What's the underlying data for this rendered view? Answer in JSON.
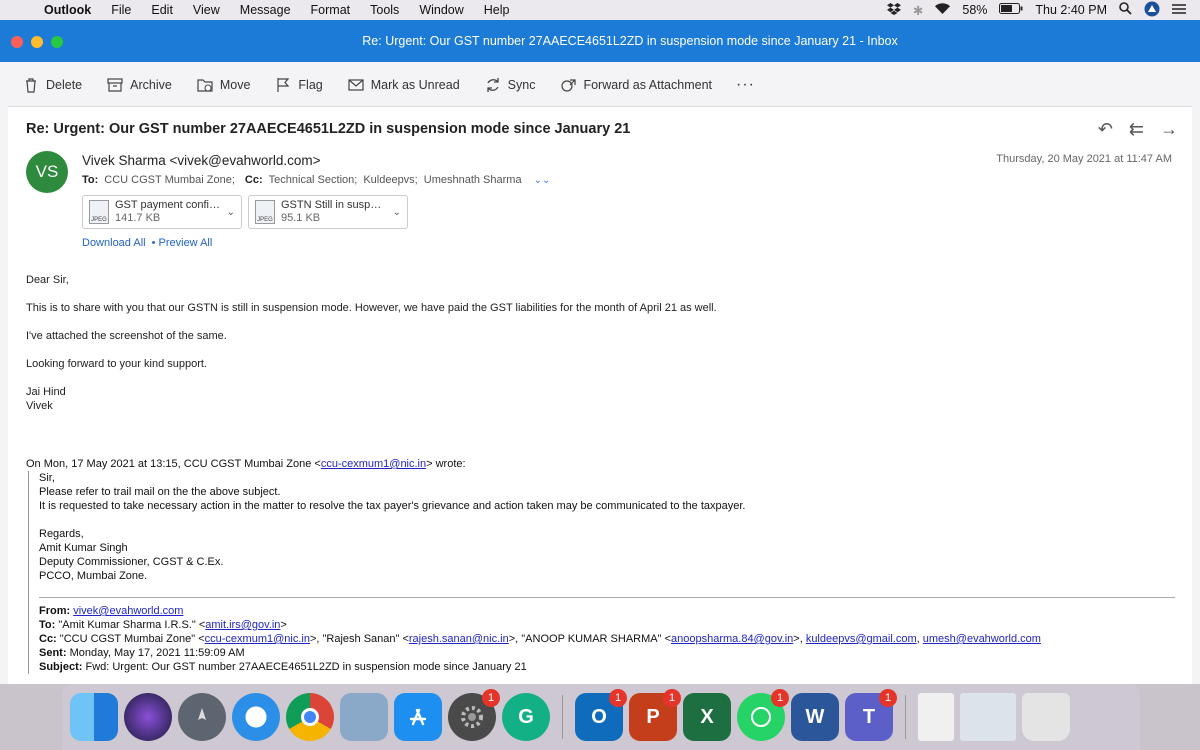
{
  "menubar": {
    "app_name": "Outlook",
    "items": [
      "File",
      "Edit",
      "View",
      "Message",
      "Format",
      "Tools",
      "Window",
      "Help"
    ],
    "battery": "58%",
    "clock": "Thu 2:40 PM"
  },
  "window": {
    "title": "Re: Urgent: Our GST number 27AAECE4651L2ZD in suspension mode since January 21 - Inbox"
  },
  "toolbar": {
    "delete": "Delete",
    "archive": "Archive",
    "move": "Move",
    "flag": "Flag",
    "mark_unread": "Mark as Unread",
    "sync": "Sync",
    "forward_attachment": "Forward as Attachment",
    "more": "···"
  },
  "message": {
    "subject": "Re: Urgent: Our GST number 27AAECE4651L2ZD in suspension mode since January 21",
    "avatar_initials": "VS",
    "sender": "Vivek Sharma <vivek@evahworld.com>",
    "date": "Thursday, 20 May 2021 at 11:47 AM",
    "to_label": "To:",
    "to": "CCU CGST Mumbai Zone;",
    "cc_label": "Cc:",
    "cc": [
      "Technical Section;",
      "Kuldeepvs;",
      "Umeshnath Sharma"
    ],
    "attachments": [
      {
        "name": "GST payment confir...",
        "size": "141.7 KB",
        "type": "JPEG"
      },
      {
        "name": "GSTN Still in suspen...",
        "size": "95.1 KB",
        "type": "JPEG"
      }
    ],
    "download_all": "Download All",
    "preview_all": "• Preview All",
    "body": [
      "Dear Sir,",
      "This is to share with you that our GSTN is still in suspension mode. However, we have paid the GST liabilities for the month of April 21 as well.",
      "I've attached the screenshot of the same.",
      "Looking forward to your kind support.",
      "Jai Hind",
      "Vivek"
    ],
    "quote": {
      "intro_pre": "On Mon, 17 May 2021 at 13:15, CCU CGST Mumbai Zone <",
      "intro_email": "ccu-cexmum1@nic.in",
      "intro_post": "> wrote:",
      "lines": [
        "Sir,",
        "Please refer to trail mail on the the above subject.",
        "It is requested to take necessary action in the matter to resolve the tax payer's grievance and action taken may be communicated to the taxpayer."
      ],
      "signature": [
        "Regards,",
        "Amit Kumar Singh",
        "Deputy Commissioner, CGST & C.Ex.",
        "PCCO, Mumbai Zone."
      ],
      "fwd": {
        "from_label": "From:",
        "from": "vivek@evahworld.com",
        "to_label": "To:",
        "to_pre": "\"Amit Kumar Sharma I.R.S.\" <",
        "to_email": "amit.irs@gov.in",
        "to_post": ">",
        "cc_label": "Cc:",
        "cc_1_pre": "\"CCU CGST Mumbai Zone\" <",
        "cc_1_email": "ccu-cexmum1@nic.in",
        "cc_2_pre": ">, \"Rajesh Sanan\" <",
        "cc_2_email": "rajesh.sanan@nic.in",
        "cc_3_pre": ">, \"ANOOP KUMAR SHARMA\" <",
        "cc_3_email": "anoopsharma.84@gov.in",
        "cc_4_pre": ">, ",
        "cc_4_email": "kuldeepvs@gmail.com",
        "cc_5_pre": ", ",
        "cc_5_email": "umesh@evahworld.com",
        "sent_label": "Sent:",
        "sent": "Monday, May 17, 2021 11:59:09 AM",
        "subject_label": "Subject:",
        "subject": "Fwd: Urgent: Our GST number 27AAECE4651L2ZD in suspension mode since January 21"
      }
    }
  },
  "dock": {
    "badges": {
      "system_preferences": "1",
      "outlook": "1",
      "powerpoint": "1",
      "whatsapp": "1",
      "teams": "1"
    },
    "labels": {
      "grammarly": "G",
      "outlook": "O",
      "powerpoint": "P",
      "excel": "X",
      "word": "W",
      "teams": "T"
    }
  },
  "colors": {
    "titlebar": "#1d7bd8",
    "avatar": "#2e8b3e",
    "link": "#2162c7",
    "badge": "#e5352a"
  }
}
